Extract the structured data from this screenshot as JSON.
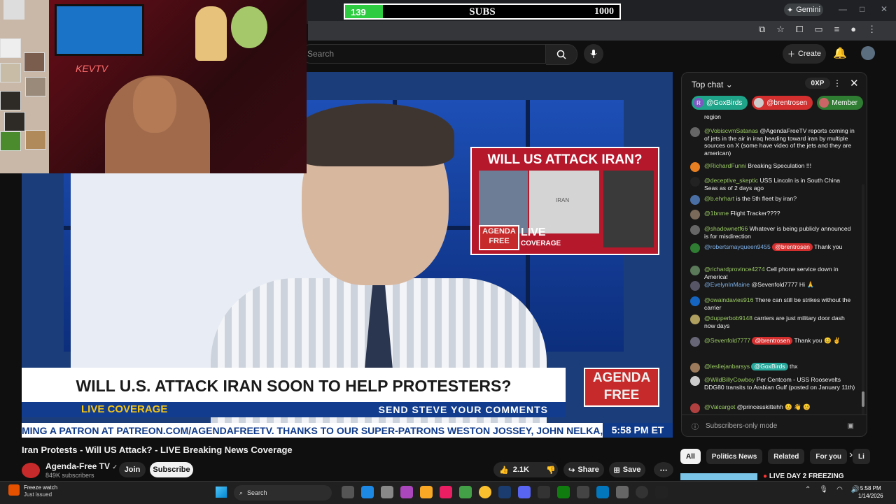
{
  "overlay": {
    "subs_current": "139",
    "subs_label": "SUBS",
    "subs_goal": "1000",
    "subs_fraction": 0.139,
    "neon_text": "KEVTV"
  },
  "browser": {
    "gemini_label": "Gemini",
    "min": "—",
    "max": "□",
    "close": "✕"
  },
  "header": {
    "search_placeholder": "Search",
    "create_label": "Create"
  },
  "video": {
    "inset_title": "WILL US ATTACK IRAN?",
    "inset_logo": "AGENDA FREE",
    "inset_live": "LIVE",
    "inset_coverage": "COVERAGE",
    "inset_map_label": "IRAN",
    "lower_third": "WILL U.S. ATTACK IRAN SOON TO HELP PROTESTERS?",
    "strip_live": "LIVE COVERAGE",
    "strip_send": "SEND STEVE YOUR COMMENTS",
    "logo_line1": "AGENDA",
    "logo_line2": "FREE",
    "ticker": "MING A PATRON AT PATREON.COM/AGENDAFREETV. THANKS TO OUR SUPER-PATRONS WESTON JOSSEY, JOHN NELKA, EMPTYMA",
    "ticker_time": "5:58 PM ET"
  },
  "info": {
    "title": "Iran Protests - Will US Attack? - LIVE Breaking News Coverage",
    "channel": "Agenda-Free TV",
    "verified": "✓",
    "subscribers": "849K subscribers",
    "join": "Join",
    "subscribe": "Subscribe",
    "likes": "2.1K",
    "share": "Share",
    "save": "Save"
  },
  "chat": {
    "mode": "Top chat",
    "xp": "0XP",
    "pins": [
      "@GoxBirds",
      "@brentrosen",
      "Member"
    ],
    "input_placeholder": "Subscribers-only mode",
    "messages": [
      {
        "author": "",
        "text": "region",
        "badge": ""
      },
      {
        "author": "@VobiscvmSatanas",
        "text": "@AgendaFreeTV reports coming in of jets in the air in iraq heading toward iran by multiple sources on X (some have video of the jets and they are american)",
        "badge": ""
      },
      {
        "author": "@RichardFunni",
        "text": "Breaking Speculation !!!",
        "badge": ""
      },
      {
        "author": "@deceptive_skeptic",
        "text": "USS Lincoln is in South China Seas as of 2 days ago",
        "badge": ""
      },
      {
        "author": "@b.ehrhart",
        "text": "is the 5th fleet by iran?",
        "badge": ""
      },
      {
        "author": "@1bnme",
        "text": "Flight Tracker????",
        "badge": ""
      },
      {
        "author": "@shadownetf66",
        "text": "Whatever is being publicly announced is for misdirection",
        "badge": ""
      },
      {
        "author": "@robertsmayqueen9455",
        "text": "Thank you",
        "badge": "@brentrosen"
      },
      {
        "author": "@richardprovince4274",
        "text": "Cell phone service down in America!",
        "badge": ""
      },
      {
        "author": "@EvelynInMaine",
        "text": "@Sevenfold7777 Hi 🙏",
        "badge": ""
      },
      {
        "author": "@owaindavies916",
        "text": "There can still be strikes without the carrier",
        "badge": ""
      },
      {
        "author": "@dupperbob9148",
        "text": "carriers are just military door dash now days",
        "badge": ""
      },
      {
        "author": "@Sevenfold7777",
        "text": "Thank you 😊 ✌",
        "badge": "@brentrosen"
      },
      {
        "author": "@lesliejanbarsys",
        "text": "thx",
        "badge": "@GoxBirds"
      },
      {
        "author": "@WildBillyCowboy",
        "text": "Per Centcom - USS Roosevelts DDG80 transits to Arabian Gulf (posted on January 11th)",
        "badge": ""
      },
      {
        "author": "@Valcargot",
        "text": "@princesskittehh 😊 👋 😊",
        "badge": ""
      }
    ]
  },
  "chips": [
    "All",
    "Politics News",
    "Related",
    "For you",
    "Li"
  ],
  "recommendation": {
    "title": "LIVE DAY 2 FREEZING"
  },
  "taskbar": {
    "notif_title": "Freeze watch",
    "notif_sub": "Just issued",
    "search": "Search",
    "time": "5:58 PM",
    "date": "1/14/2026"
  }
}
